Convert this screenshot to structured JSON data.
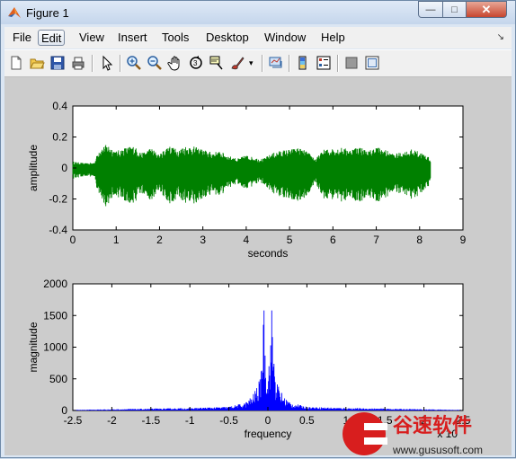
{
  "window": {
    "title": "Figure 1",
    "controls": {
      "minimize": "—",
      "maximize": "□",
      "close": "✕"
    }
  },
  "menu": {
    "items": [
      {
        "label": "File"
      },
      {
        "label": "Edit"
      },
      {
        "label": "View"
      },
      {
        "label": "Insert"
      },
      {
        "label": "Tools"
      },
      {
        "label": "Desktop"
      },
      {
        "label": "Window"
      },
      {
        "label": "Help"
      }
    ],
    "active_index": 1
  },
  "toolbar": {
    "icons": [
      "new-figure-icon",
      "open-file-icon",
      "save-icon",
      "print-icon",
      "pointer-icon",
      "zoom-in-icon",
      "zoom-out-icon",
      "pan-icon",
      "rotate-3d-icon",
      "data-cursor-icon",
      "brush-icon",
      "link-plot-icon",
      "colorbar-icon",
      "legend-icon",
      "hide-plot-tools-icon",
      "show-plot-tools-icon"
    ]
  },
  "chart_data": [
    {
      "type": "line",
      "title": "",
      "xlabel": "seconds",
      "ylabel": "amplitude",
      "xlim": [
        0,
        9
      ],
      "ylim": [
        -0.4,
        0.4
      ],
      "xticks": [
        "0",
        "1",
        "2",
        "3",
        "4",
        "5",
        "6",
        "7",
        "8",
        "9"
      ],
      "yticks": [
        "0.4",
        "0.2",
        "0",
        "-0.2",
        "-0.4"
      ],
      "color": "#008000",
      "series": [
        {
          "x": [
            0,
            0.3,
            0.5,
            0.6,
            0.8,
            1.0,
            1.2,
            1.4,
            1.6,
            1.8,
            2.0,
            2.2,
            2.4,
            2.6,
            2.8,
            3.0,
            3.2,
            3.4,
            3.6,
            3.8,
            4.0,
            4.2,
            4.4,
            4.6,
            4.8,
            5.0,
            5.2,
            5.4,
            5.6,
            5.8,
            6.0,
            6.2,
            6.4,
            6.6,
            6.8,
            7.0,
            7.2,
            7.4,
            7.6,
            7.8,
            8.0,
            8.2,
            8.25
          ],
          "envelope": [
            0.07,
            0.05,
            0.06,
            0.2,
            0.26,
            0.18,
            0.22,
            0.24,
            0.16,
            0.22,
            0.14,
            0.25,
            0.2,
            0.24,
            0.23,
            0.2,
            0.17,
            0.18,
            0.13,
            0.1,
            0.14,
            0.11,
            0.1,
            0.16,
            0.19,
            0.2,
            0.22,
            0.18,
            0.1,
            0.2,
            0.21,
            0.22,
            0.2,
            0.24,
            0.18,
            0.23,
            0.2,
            0.15,
            0.17,
            0.2,
            0.18,
            0.12,
            0.09
          ]
        }
      ]
    },
    {
      "type": "line",
      "title": "",
      "xlabel": "frequency",
      "ylabel": "magnitude",
      "xlim": [
        -2.5,
        2.5
      ],
      "ylim": [
        0,
        2000
      ],
      "xticks": [
        "-2.5",
        "-2",
        "-1.5",
        "-1",
        "-0.5",
        "0",
        "0.5",
        "1",
        "1.5",
        "2",
        "2.5"
      ],
      "yticks": [
        "2000",
        "1500",
        "1000",
        "500",
        "0"
      ],
      "x_multiplier_label": "x 10",
      "color": "#0000ff",
      "series": [
        {
          "x": [
            -2.5,
            -2.0,
            -1.5,
            -1.0,
            -0.5,
            -0.3,
            -0.2,
            -0.1,
            -0.05,
            -0.03,
            0,
            0.03,
            0.05,
            0.1,
            0.2,
            0.3,
            0.5,
            1.0,
            1.5,
            2.0,
            2.5
          ],
          "y": [
            10,
            20,
            30,
            40,
            60,
            120,
            230,
            500,
            1580,
            900,
            600,
            1100,
            1580,
            500,
            230,
            120,
            60,
            40,
            30,
            20,
            10
          ]
        }
      ]
    }
  ]
}
